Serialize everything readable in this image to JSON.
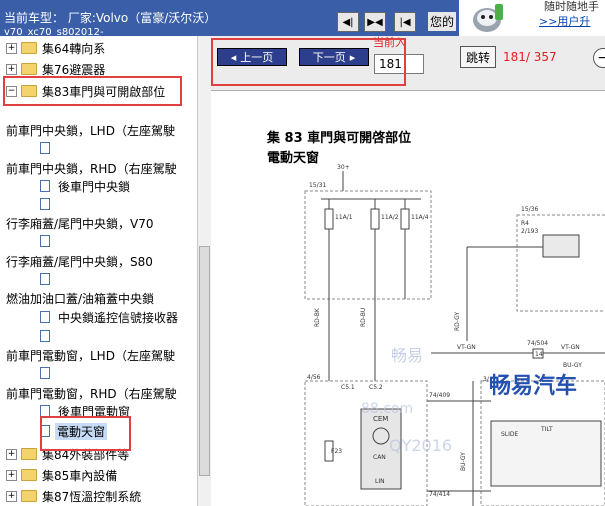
{
  "header": {
    "car_label": "当前车型：  厂家:Volvo（富豪/沃尔沃）",
    "car_sub": "v70_xc70_s802012-",
    "your_label": "您的",
    "nav_buttons": [
      "◀|",
      "▶◀",
      "|◀"
    ]
  },
  "ad": {
    "line1": "随时随地手",
    "line2": ">>用户升"
  },
  "tree": {
    "items": [
      {
        "label": "集64轉向系"
      },
      {
        "label": "集76避震器"
      },
      {
        "label": "集83車門與可開啟部位"
      },
      {
        "label": "前車門中央鎖，LHD（左座駕駛"
      },
      {
        "label": "前車門中央鎖，RHD（右座駕駛"
      },
      {
        "label": "後車門中央鎖"
      },
      {
        "label": "行李廂蓋/尾門中央鎖，V70"
      },
      {
        "label": "行李廂蓋/尾門中央鎖，S80"
      },
      {
        "label": "燃油加油口蓋/油箱蓋中央鎖"
      },
      {
        "label": "中央鎖遙控信號接收器"
      },
      {
        "label": "前車門電動窗，LHD（左座駕駛"
      },
      {
        "label": "前車門電動窗，RHD（右座駕駛"
      },
      {
        "label": "後車門電動窗"
      },
      {
        "label": "電動天窗"
      },
      {
        "label": "集84外裝部件等"
      },
      {
        "label": "集85車內設備"
      },
      {
        "label": "集87恆溫控制系統"
      }
    ]
  },
  "toolbar": {
    "prev_label": "上一页",
    "next_label": "下一页",
    "current_label": "当前入",
    "page_value": "181",
    "jump_label": "跳转",
    "page_count": "181/ 357",
    "zoom_icon": "−"
  },
  "document": {
    "title1": "集 83 車門與可開啓部位",
    "title2": "電動天窗",
    "labels": {
      "bus_top": "30+",
      "left_ref": "15/31",
      "right_ref": "15/36",
      "fuse1": "11A/1",
      "fuse2": "11A/2",
      "fuse3": "11A/4",
      "relay": "R4",
      "relay_ref": "2/193",
      "conn1": "74/504",
      "wire1": "VT-GN",
      "wire2": "VT-GN",
      "wire3": "BU-GY",
      "pin14": "14",
      "ref456": "4/56",
      "ref74409": "74/409",
      "ref74414": "74/414",
      "ref3": "3/",
      "c51": "C5.1",
      "c52": "C5.2",
      "cem": "CEM",
      "f23": "F23",
      "can": "CAN",
      "lin": "LIN",
      "slide": "SLIDE",
      "tilt": "TILT",
      "rd_bk": "RD-BK",
      "rd_bu": "RD-BU",
      "rd_gy": "RD-GY",
      "bu_gy": "BU-GY"
    },
    "watermarks": {
      "wm1": "畅易",
      "wm2": "畅易汽车",
      "wm3": "88.com",
      "wm4": "QY2016"
    }
  }
}
